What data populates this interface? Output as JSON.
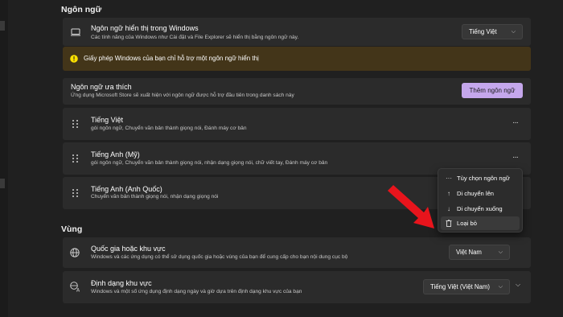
{
  "sections": {
    "language_title": "Ngôn ngữ",
    "region_title": "Vùng"
  },
  "display_language": {
    "title": "Ngôn ngữ hiển thị trong Windows",
    "desc": "Các tính năng của Windows như Cài đặt và File Explorer sẽ hiển thị bằng ngôn ngữ này.",
    "value": "Tiếng Việt",
    "icon": "monitor-icon"
  },
  "license_warning": {
    "text": "Giấy phép Windows của bạn chỉ hỗ trợ một ngôn ngữ hiển thị",
    "color": "#fce100",
    "background": "#433519"
  },
  "preferred_languages": {
    "title": "Ngôn ngữ ưa thích",
    "desc": "Ứng dụng Microsoft Store sẽ xuất hiện với ngôn ngữ được hỗ trợ đầu tiên trong danh sách này",
    "add_button": "Thêm ngôn ngữ",
    "accent": "#c5a7ec"
  },
  "languages": [
    {
      "name": "Tiếng Việt",
      "features": "gói ngôn ngữ, Chuyển văn bản thành giọng nói, Đánh máy cơ bản"
    },
    {
      "name": "Tiếng Anh (Mỹ)",
      "features": "gói ngôn ngữ, Chuyển văn bản thành giọng nói, nhận dạng giọng nói, chữ viết tay, Đánh máy cơ bản"
    },
    {
      "name": "Tiếng Anh (Anh Quốc)",
      "features": "Chuyển văn bản thành giọng nói, nhận dạng giọng nói"
    }
  ],
  "context_menu": {
    "items": [
      {
        "label": "Tùy chọn ngôn ngữ",
        "icon": "more-icon"
      },
      {
        "label": "Di chuyển lên",
        "icon": "arrow-up-icon"
      },
      {
        "label": "Di chuyển xuống",
        "icon": "arrow-down-icon"
      },
      {
        "label": "Loại bỏ",
        "icon": "trash-icon"
      }
    ]
  },
  "country": {
    "title": "Quốc gia hoặc khu vực",
    "desc": "Windows và các ứng dụng có thể sử dụng quốc gia hoặc vùng của bạn để cung cấp cho bạn nội dung cục bộ",
    "value": "Việt Nam",
    "icon": "globe-icon"
  },
  "regional_format": {
    "title": "Định dạng khu vực",
    "desc": "Windows và một số ứng dụng định dạng ngày và giờ dựa trên định dạng khu vực của bạn",
    "value": "Tiếng Việt (Việt Nam)",
    "icon": "regional-format-icon"
  },
  "annotation_arrow_color": "#e8141c"
}
